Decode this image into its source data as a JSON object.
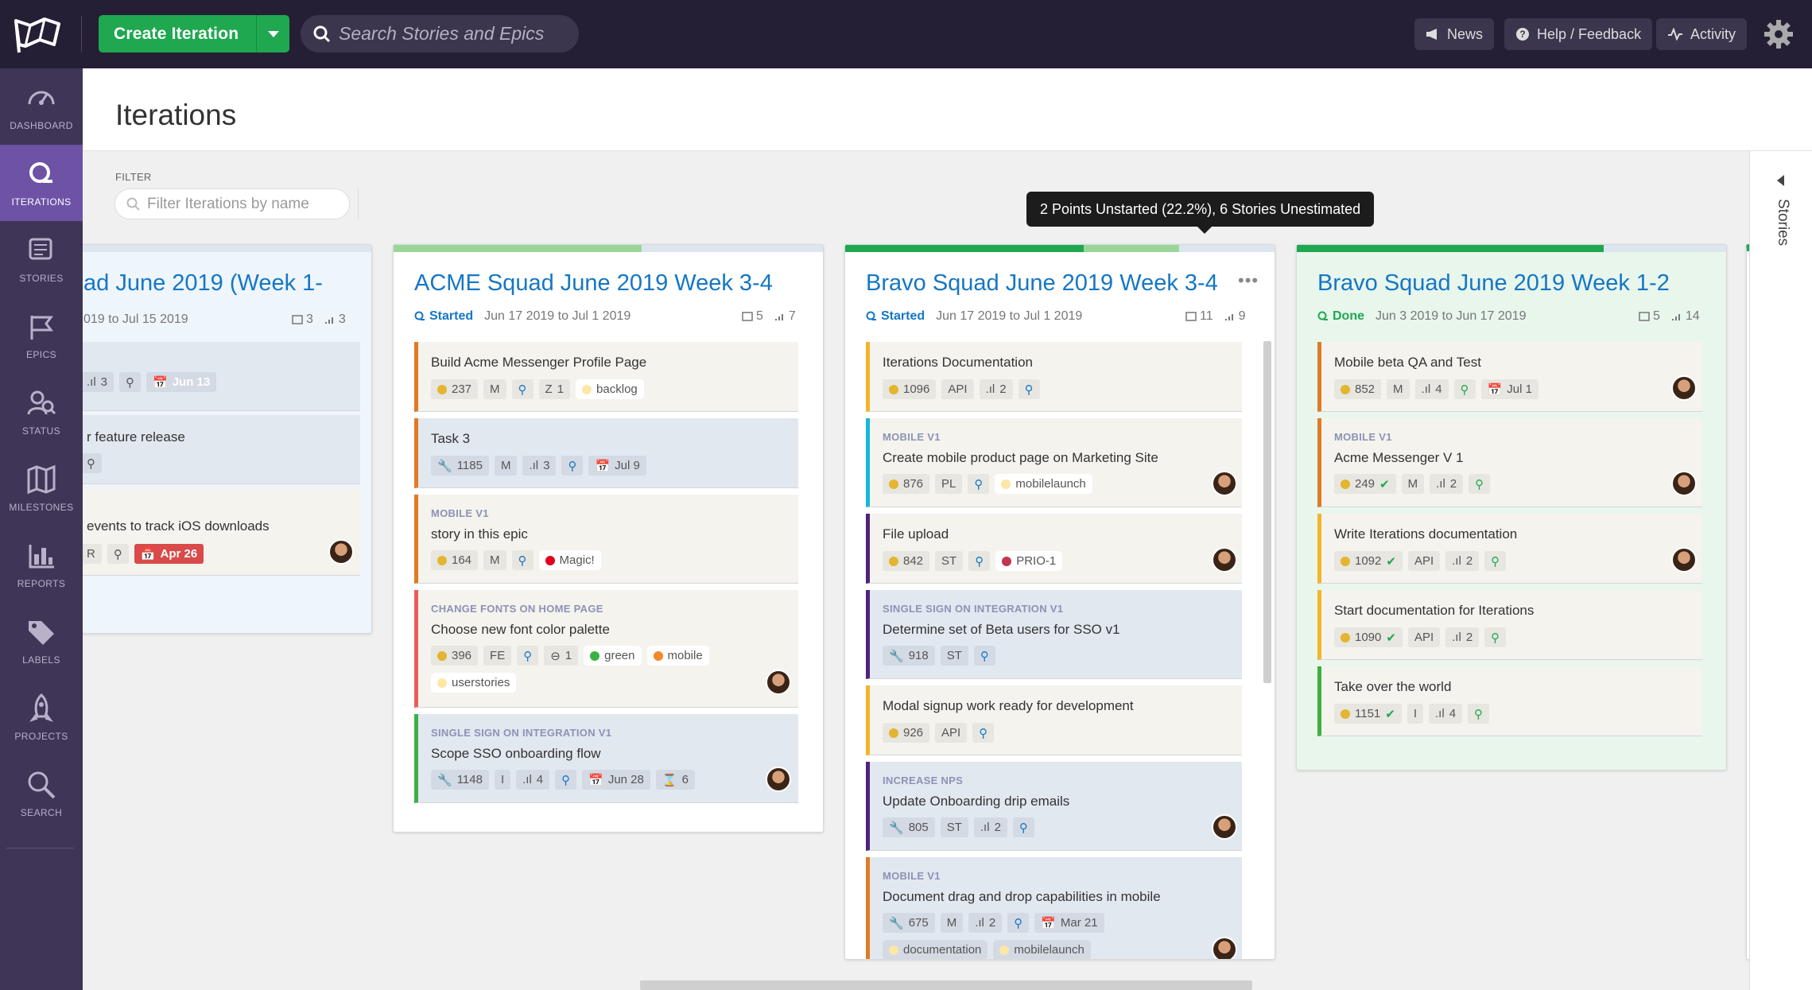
{
  "topbar": {
    "create_label": "Create Iteration",
    "search_placeholder": "Search Stories and Epics",
    "news": "News",
    "help": "Help / Feedback",
    "activity": "Activity"
  },
  "sidebar": {
    "items": [
      {
        "label": "DASHBOARD",
        "icon": "dashboard-icon"
      },
      {
        "label": "ITERATIONS",
        "icon": "iterations-icon"
      },
      {
        "label": "STORIES",
        "icon": "stories-icon"
      },
      {
        "label": "EPICS",
        "icon": "epics-icon"
      },
      {
        "label": "STATUS",
        "icon": "status-icon"
      },
      {
        "label": "MILESTONES",
        "icon": "milestones-icon"
      },
      {
        "label": "REPORTS",
        "icon": "reports-icon"
      },
      {
        "label": "LABELS",
        "icon": "labels-icon"
      },
      {
        "label": "PROJECTS",
        "icon": "projects-icon"
      },
      {
        "label": "SEARCH",
        "icon": "search-icon"
      }
    ]
  },
  "page": {
    "title": "Iterations",
    "filter_label": "FILTER",
    "filter_placeholder": "Filter Iterations by name",
    "tooltip": "2 Points Unstarted (22.2%), 6 Stories Unestimated",
    "stories_panel": "Stories"
  },
  "columns": {
    "c0": {
      "title": "ad June 2019 (Week 1-",
      "dates": "019 to Jul 15 2019",
      "stories": "3",
      "points": "3",
      "cards": [
        {
          "name": "",
          "est": "3",
          "date": "Jun 13"
        },
        {
          "name": "r feature release"
        },
        {
          "name": "events to track iOS downloads",
          "tagA": "R",
          "date": "Apr 26"
        }
      ]
    },
    "c1": {
      "title": "ACME Squad June 2019 Week 3-4",
      "status": "Started",
      "dates": "Jun 17 2019 to Jul 1 2019",
      "stories": "5",
      "points": "7",
      "cards": [
        {
          "name": "Build Acme Messenger Profile Page",
          "id": "237",
          "team": "M",
          "zendesk": "1",
          "label": "backlog"
        },
        {
          "name": "Task 3",
          "id": "1185",
          "team": "M",
          "est": "3",
          "date": "Jul 9"
        },
        {
          "epic": "MOBILE V1",
          "name": "story in this epic",
          "id": "164",
          "team": "M",
          "label": "Magic!"
        },
        {
          "epic": "CHANGE FONTS ON HOME PAGE",
          "name": "Choose new font color palette",
          "id": "396",
          "team": "FE",
          "blocked": "1",
          "label1": "green",
          "label2": "mobile",
          "label3": "userstories"
        },
        {
          "epic": "SINGLE SIGN ON INTEGRATION V1",
          "name": "Scope SSO onboarding flow",
          "id": "1148",
          "team": "I",
          "est": "4",
          "date": "Jun 28",
          "hours": "6"
        }
      ]
    },
    "c2": {
      "title": "Bravo Squad June 2019 Week 3-4",
      "status": "Started",
      "dates": "Jun 17 2019 to Jul 1 2019",
      "stories": "11",
      "points": "9",
      "cards": [
        {
          "name": "Iterations Documentation",
          "id": "1096",
          "team": "API",
          "est": "2"
        },
        {
          "epic": "MOBILE V1",
          "name": "Create mobile product page on Marketing Site",
          "id": "876",
          "team": "PL",
          "label": "mobilelaunch"
        },
        {
          "name": "File upload",
          "id": "842",
          "team": "ST",
          "label": "PRIO-1"
        },
        {
          "epic": "SINGLE SIGN ON INTEGRATION V1",
          "name": "Determine set of Beta users for SSO v1",
          "id": "918",
          "team": "ST"
        },
        {
          "name": "Modal signup work ready for development",
          "id": "926",
          "team": "API"
        },
        {
          "epic": "INCREASE NPS",
          "name": "Update Onboarding drip emails",
          "id": "805",
          "team": "ST",
          "est": "2"
        },
        {
          "epic": "MOBILE V1",
          "name": "Document drag and drop capabilities in mobile",
          "id": "675",
          "team": "M",
          "est": "2",
          "date": "Mar 21",
          "label1": "documentation",
          "label2": "mobilelaunch"
        }
      ]
    },
    "c3": {
      "title": "Bravo Squad June 2019 Week 1-2",
      "status": "Done",
      "dates": "Jun 3 2019 to Jun 17 2019",
      "stories": "5",
      "points": "14",
      "cards": [
        {
          "name": "Mobile beta QA and Test",
          "id": "852",
          "team": "M",
          "est": "4",
          "date": "Jul 1"
        },
        {
          "epic": "MOBILE V1",
          "name": "Acme Messenger V 1",
          "id": "249",
          "team": "M",
          "est": "2"
        },
        {
          "name": "Write Iterations documentation",
          "id": "1092",
          "team": "API",
          "est": "2"
        },
        {
          "name": "Start documentation for Iterations",
          "id": "1090",
          "team": "API",
          "est": "2"
        },
        {
          "name": "Take over the world",
          "id": "1151",
          "team": "I",
          "est": "4"
        }
      ]
    }
  },
  "colors": {
    "topbar": "#251f36",
    "sidebar": "#3f3557",
    "sidebar_active": "#6d52a6",
    "primary_green": "#1fa84f",
    "title_blue": "#1577c5"
  }
}
